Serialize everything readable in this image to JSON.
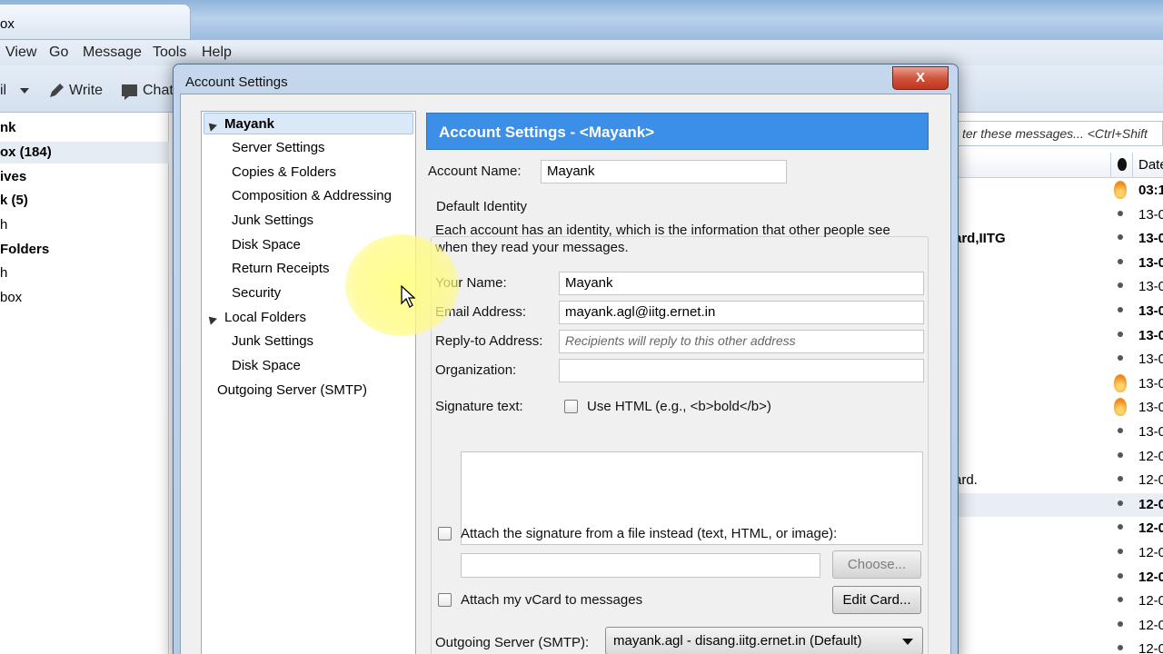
{
  "background_window": {
    "tab_title": "ox",
    "menu": [
      "View",
      "Go",
      "Message",
      "Tools",
      "Help"
    ],
    "toolbar": {
      "get_mail": "il",
      "write": "Write",
      "chat": "Chat"
    },
    "folders": [
      {
        "label": "nk",
        "bold": true
      },
      {
        "label": "ox (184)",
        "bold": true
      },
      {
        "label": "ives",
        "bold": true
      },
      {
        "label": "k (5)",
        "bold": true
      },
      {
        "label": "h",
        "bold": false
      },
      {
        "label": "Folders",
        "bold": true
      },
      {
        "label": "h",
        "bold": false
      },
      {
        "label": "box",
        "bold": false
      }
    ],
    "filter_placeholder": "ter these messages... <Ctrl+Shift",
    "date_header": "Date",
    "messages": [
      {
        "sender": "",
        "date": "03:1",
        "bold": true,
        "flame": true
      },
      {
        "sender": "",
        "date": "13-0",
        "bold": false,
        "flame": false
      },
      {
        "sender": "ard,IITG",
        "date": "13-0",
        "bold": true,
        "flame": false
      },
      {
        "sender": "",
        "date": "13-0",
        "bold": true,
        "flame": false
      },
      {
        "sender": "",
        "date": "13-0",
        "bold": false,
        "flame": false
      },
      {
        "sender": "",
        "date": "13-0",
        "bold": true,
        "flame": false
      },
      {
        "sender": "",
        "date": "13-0",
        "bold": true,
        "flame": false
      },
      {
        "sender": "",
        "date": "13-0",
        "bold": false,
        "flame": false
      },
      {
        "sender": "",
        "date": "13-0",
        "bold": false,
        "flame": true
      },
      {
        "sender": "",
        "date": "13-0",
        "bold": false,
        "flame": true
      },
      {
        "sender": "",
        "date": "13-0",
        "bold": false,
        "flame": false
      },
      {
        "sender": "",
        "date": "12-0",
        "bold": false,
        "flame": false
      },
      {
        "sender": "ard.",
        "date": "12-0",
        "bold": false,
        "flame": false
      },
      {
        "sender": "",
        "date": "12-0",
        "bold": true,
        "flame": false,
        "selected": true
      },
      {
        "sender": "",
        "date": "12-0",
        "bold": true,
        "flame": false
      },
      {
        "sender": "",
        "date": "12-0",
        "bold": false,
        "flame": false
      },
      {
        "sender": "",
        "date": "12-0",
        "bold": true,
        "flame": false
      },
      {
        "sender": "",
        "date": "12-0",
        "bold": false,
        "flame": false
      },
      {
        "sender": "",
        "date": "12-0",
        "bold": false,
        "flame": false
      },
      {
        "sender": "",
        "date": "12-0",
        "bold": false,
        "flame": false
      }
    ]
  },
  "dialog": {
    "title": "Account Settings",
    "close": "X",
    "tree": [
      {
        "label": "Mayank",
        "level": 0,
        "expanded": true,
        "selected": true,
        "bold": true
      },
      {
        "label": "Server Settings",
        "level": 1
      },
      {
        "label": "Copies & Folders",
        "level": 1
      },
      {
        "label": "Composition & Addressing",
        "level": 1
      },
      {
        "label": "Junk Settings",
        "level": 1
      },
      {
        "label": "Disk Space",
        "level": 1
      },
      {
        "label": "Return Receipts",
        "level": 1
      },
      {
        "label": "Security",
        "level": 1
      },
      {
        "label": "Local Folders",
        "level": 0,
        "expanded": true
      },
      {
        "label": "Junk Settings",
        "level": 1
      },
      {
        "label": "Disk Space",
        "level": 1
      },
      {
        "label": "Outgoing Server (SMTP)",
        "level": 0
      }
    ],
    "header_title": "Account Settings - <Mayank>",
    "account_name_label": "Account Name:",
    "account_name_value": "Mayank",
    "default_identity_label": "Default Identity",
    "identity_description": "Each account has an identity, which is the information that other people see",
    "identity_description_2": "when they read your messages.",
    "your_name_label": "Your Name:",
    "your_name_value": "Mayank",
    "email_label": "Email Address:",
    "email_value": "mayank.agl@iitg.ernet.in",
    "reply_to_label": "Reply-to Address:",
    "reply_to_placeholder": "Recipients will reply to this other address",
    "organization_label": "Organization:",
    "organization_value": "",
    "signature_label": "Signature text:",
    "use_html_label": "Use HTML (e.g., <b>bold</b>)",
    "use_html_checked": false,
    "attach_sig_label": "Attach the signature from a file instead (text, HTML, or image):",
    "attach_sig_checked": false,
    "sig_file_value": "",
    "choose_button": "Choose...",
    "attach_vcard_label": "Attach my vCard to messages",
    "attach_vcard_checked": false,
    "edit_card_button": "Edit Card...",
    "smtp_label": "Outgoing Server (SMTP):",
    "smtp_value": "mayank.agl - disang.iitg.ernet.in (Default)"
  },
  "colors": {
    "header_blue": "#3c8fe6",
    "close_red": "#c1341c",
    "cursor_highlight": "#ffff78"
  }
}
